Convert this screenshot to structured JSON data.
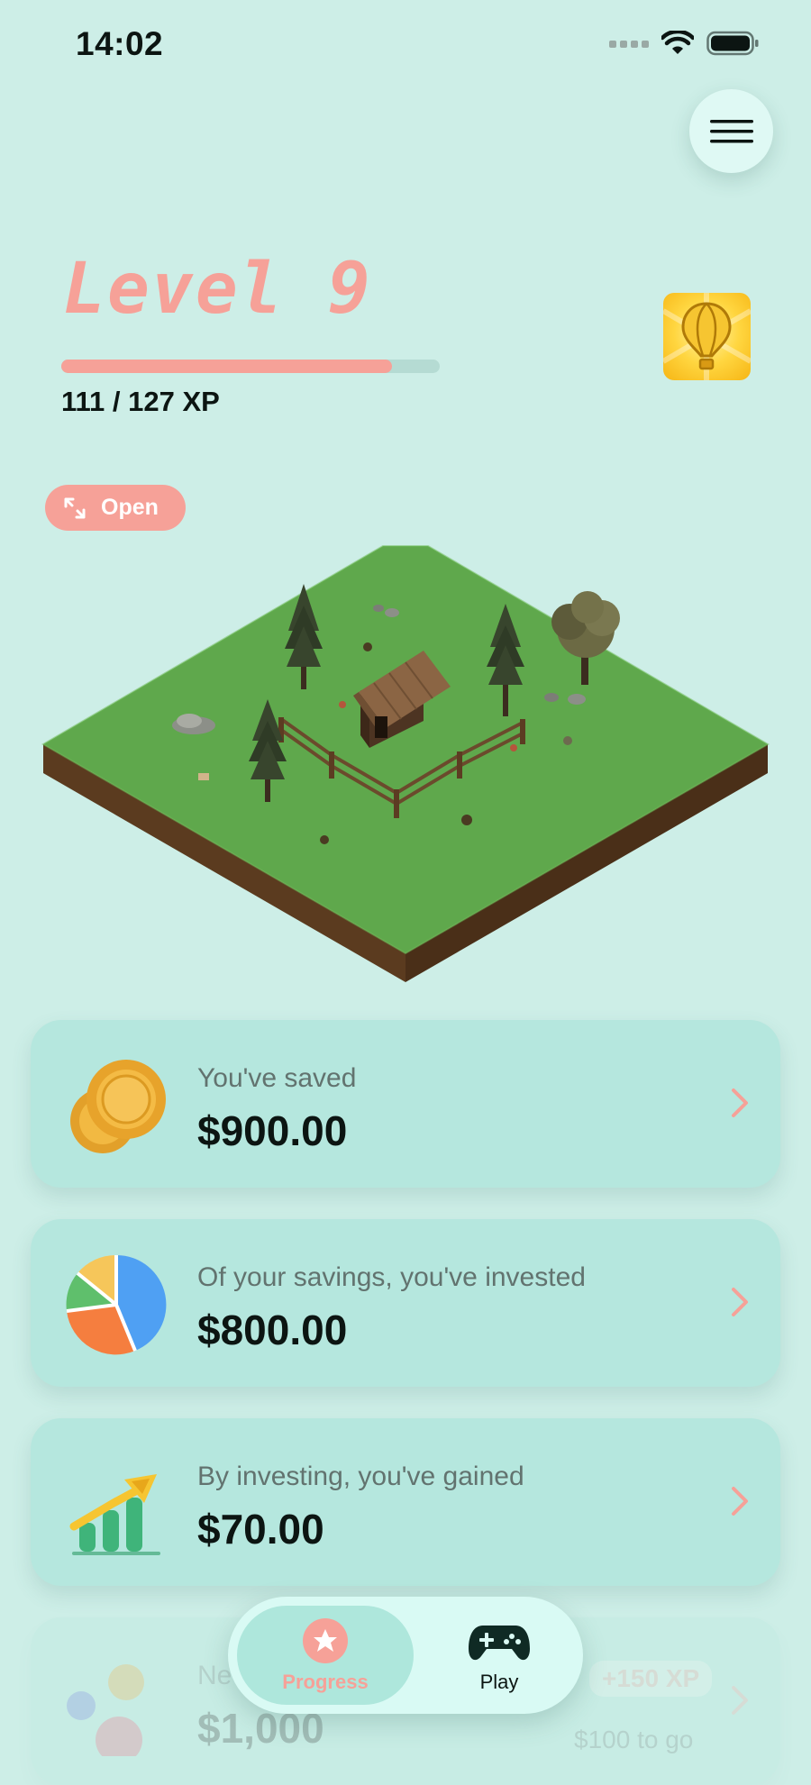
{
  "status_bar": {
    "time": "14:02"
  },
  "menu": {
    "icon": "hamburger-menu-icon"
  },
  "level": {
    "title": "Level 9",
    "xp_current": 111,
    "xp_total": 127,
    "xp_fraction": 0.874,
    "xp_text": "111 / 127 XP",
    "badge_icon": "hot-air-balloon-icon"
  },
  "open_button": {
    "label": "Open",
    "icon": "expand-arrows-icon"
  },
  "cards": [
    {
      "label": "You've saved",
      "value": "$900.00",
      "icon": "coins-icon"
    },
    {
      "label": "Of your savings, you've invested",
      "value": "$800.00",
      "icon": "pie-chart-icon"
    },
    {
      "label": "By investing, you've gained",
      "value": "$70.00",
      "icon": "growth-chart-icon"
    },
    {
      "label": "Ne",
      "value": "$1,000",
      "xp_badge": "+150 XP",
      "togo": "$100 to go",
      "icon": "flowers-icon"
    }
  ],
  "bottom_nav": {
    "tabs": [
      {
        "label": "Progress",
        "icon": "star-icon",
        "active": true
      },
      {
        "label": "Play",
        "icon": "gamepad-icon",
        "active": false
      }
    ]
  },
  "colors": {
    "background": "#cdeee7",
    "accent": "#f6a198",
    "card": "#b5e7de",
    "text": "#0c1512",
    "muted": "#62736f"
  }
}
